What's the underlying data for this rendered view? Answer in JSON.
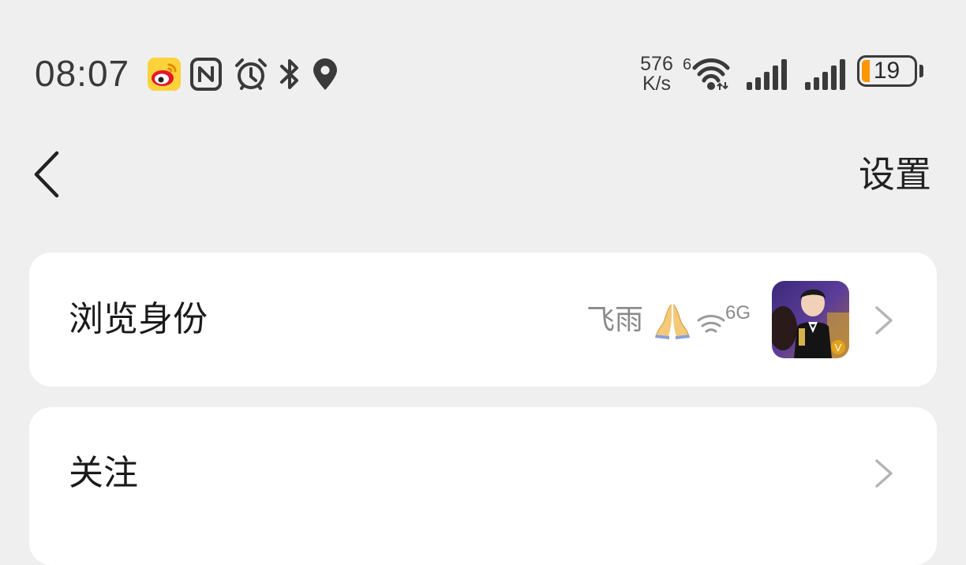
{
  "status_bar": {
    "time": "08:07",
    "net_speed_value": "576",
    "net_speed_unit": "K/s",
    "wifi_badge": "6",
    "battery_level": "19",
    "icons": [
      "weibo-icon",
      "nfc-icon",
      "alarm-icon",
      "bluetooth-icon",
      "location-icon",
      "wifi-icon",
      "signal-icon",
      "signal-icon",
      "battery-icon"
    ]
  },
  "nav": {
    "back_icon": "chevron-left-icon",
    "settings_label": "设置"
  },
  "rows": [
    {
      "label": "浏览身份",
      "value_name": "飞雨",
      "value_emoji": "pray-emoji",
      "value_suffix": "6G",
      "avatar_badge": "V"
    },
    {
      "label": "关注"
    }
  ],
  "colors": {
    "background": "#efefef",
    "card": "#ffffff",
    "battery_low": "#ff9500",
    "weibo_yellow": "#fdd23a",
    "weibo_red": "#e6162d",
    "secondary_text": "#8a8a8a"
  }
}
